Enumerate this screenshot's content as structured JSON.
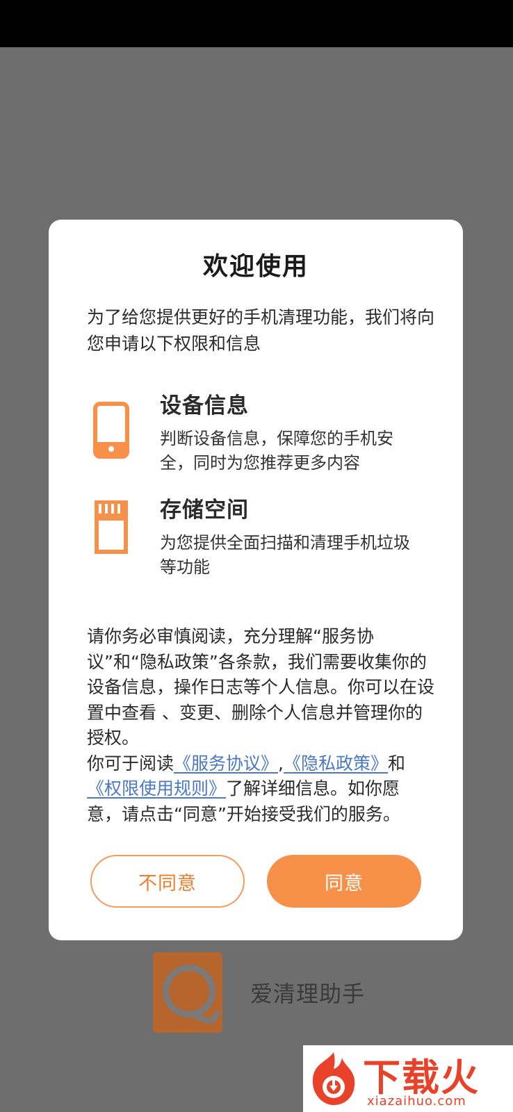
{
  "background_app": {
    "name": "爱清理助手"
  },
  "dialog": {
    "title": "欢迎使用",
    "intro": "为了给您提供更好的手机清理功能，我们将向您申请以下权限和信息",
    "permissions": [
      {
        "icon": "phone-icon",
        "title": "设备信息",
        "description": "判断设备信息，保障您的手机安全，同时为您推荐更多内容"
      },
      {
        "icon": "sd-card-icon",
        "title": "存储空间",
        "description": "为您提供全面扫描和清理手机垃圾等功能"
      }
    ],
    "policy": {
      "paragraph1": "请你务必审慎阅读，充分理解“服务协议”和“隐私政策”各条款，我们需要收集你的设备信息，操作日志等个人信息。你可以在设置中查看 、变更、删除个人信息并管理你的授权。",
      "prefix": "你可于阅读",
      "link_service": "《服务协议》",
      "sep1": ",",
      "link_privacy": "《隐私政策》",
      "sep2": "和",
      "link_permission": "《权限使用规则》",
      "suffix": "了解详细信息。如你愿意，请点击“同意”开始接受我们的服务。"
    },
    "buttons": {
      "disagree": "不同意",
      "agree": "同意"
    }
  },
  "watermark": {
    "text": "下载火",
    "url": "xiazaihuo.com"
  },
  "colors": {
    "accent": "#f7914a",
    "link": "#4a78c4",
    "overlay": "#6e6e6e",
    "watermark": "#e8432a"
  }
}
